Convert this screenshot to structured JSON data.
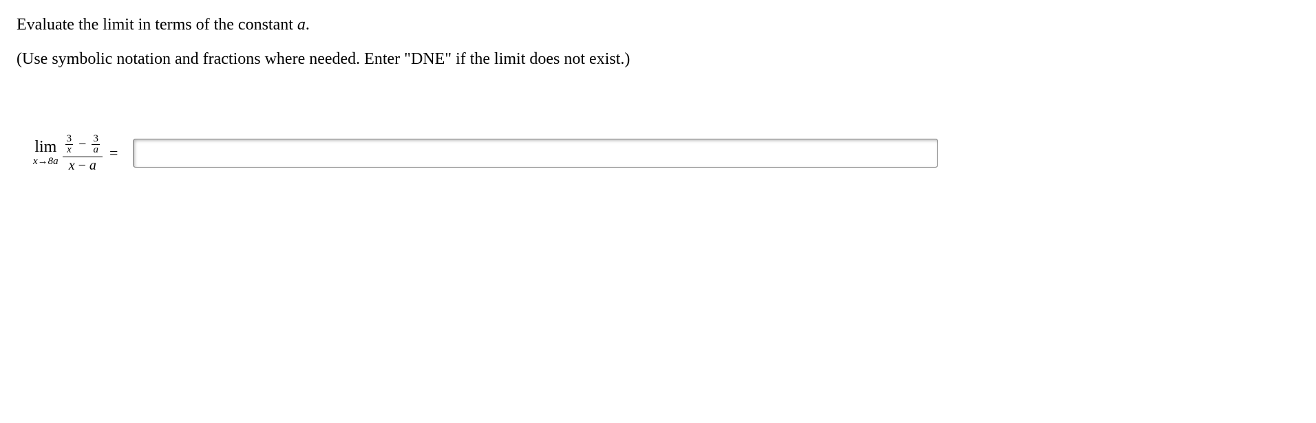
{
  "prompt": {
    "line1_pre": "Evaluate the limit in terms of the constant ",
    "line1_var": "a",
    "line1_post": ".",
    "line2": "(Use symbolic notation and fractions where needed. Enter \"DNE\" if the limit does not exist.)"
  },
  "math": {
    "lim_label": "lim",
    "lim_sub_x": "x",
    "lim_sub_arrow": "→",
    "lim_sub_target": "8a",
    "frac1_num": "3",
    "frac1_den": "x",
    "minus": "−",
    "frac2_num": "3",
    "frac2_den": "a",
    "big_den_x": "x",
    "big_den_minus": " − ",
    "big_den_a": "a",
    "equals": "="
  },
  "answer": {
    "value": "",
    "placeholder": ""
  }
}
